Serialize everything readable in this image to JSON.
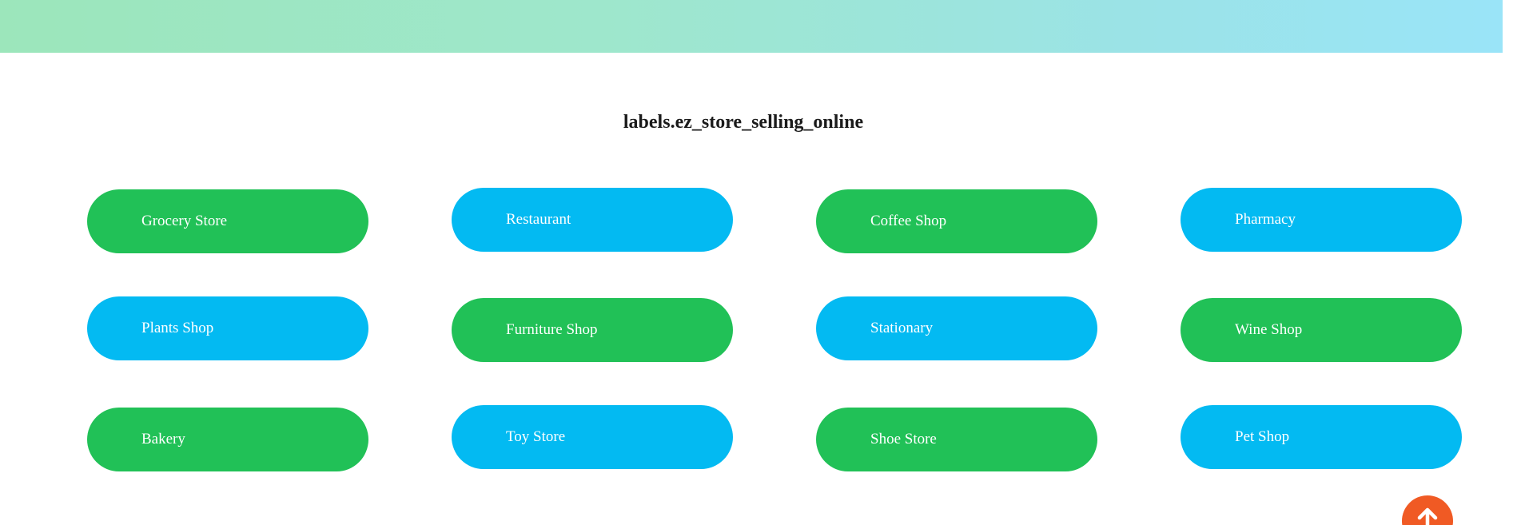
{
  "section": {
    "title": "labels.ez_store_selling_online"
  },
  "store_types": [
    {
      "label": "Grocery Store",
      "color": "#21c157"
    },
    {
      "label": "Restaurant",
      "color": "#03baf2"
    },
    {
      "label": "Coffee Shop",
      "color": "#21c157"
    },
    {
      "label": "Pharmacy",
      "color": "#03baf2"
    },
    {
      "label": "Plants Shop",
      "color": "#03baf2"
    },
    {
      "label": "Furniture Shop",
      "color": "#21c157"
    },
    {
      "label": "Stationary",
      "color": "#03baf2"
    },
    {
      "label": "Wine Shop",
      "color": "#21c157"
    },
    {
      "label": "Bakery",
      "color": "#21c157"
    },
    {
      "label": "Toy Store",
      "color": "#03baf2"
    },
    {
      "label": "Shoe Store",
      "color": "#21c157"
    },
    {
      "label": "Pet Shop",
      "color": "#03baf2"
    }
  ],
  "scroll_top": {
    "icon": "arrow-up-icon",
    "color": "#f05a24"
  }
}
